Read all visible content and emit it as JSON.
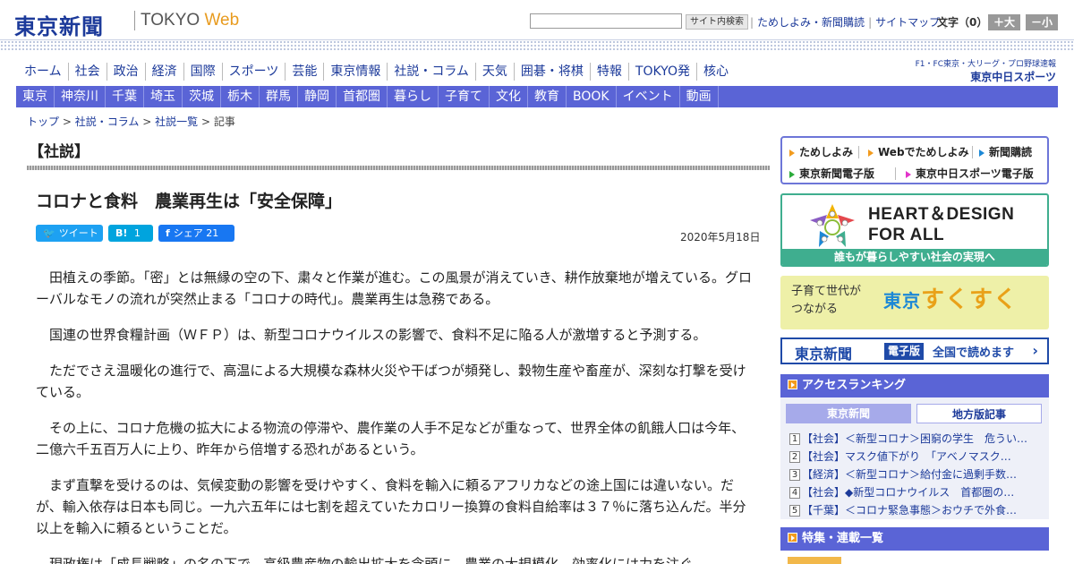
{
  "header": {
    "logo": "東京新聞",
    "brand_tokyo": "TOKYO",
    "brand_web": "Web",
    "search_button": "サイト内検索",
    "links": [
      "ためしよみ・新聞購読",
      "サイトマップ"
    ],
    "font_size_label": "文字（0）",
    "font_big": "＋大",
    "font_small": "－小"
  },
  "nav_primary": [
    "ホーム",
    "社会",
    "政治",
    "経済",
    "国際",
    "スポーツ",
    "芸能",
    "東京情報",
    "社説・コラム",
    "天気",
    "囲碁・将棋",
    "特報",
    "TOKYO発",
    "核心"
  ],
  "sports_logo": {
    "line1": "F1・FC東京・大リーグ・プロ野球速報",
    "line2": "東京中日スポーツ"
  },
  "nav_secondary": [
    "東京",
    "神奈川",
    "千葉",
    "埼玉",
    "茨城",
    "栃木",
    "群馬",
    "静岡",
    "首都圏",
    "暮らし",
    "子育て",
    "文化",
    "教育",
    "BOOK",
    "イベント",
    "動画"
  ],
  "breadcrumb": {
    "items": [
      "トップ",
      "社説・コラム",
      "社説一覧"
    ],
    "current": "記事",
    "sep": ">"
  },
  "article": {
    "section": "【社説】",
    "title": "コロナと食料　農業再生は「安全保障」",
    "share": {
      "tweet": "ツイート",
      "hatena_icon": "B!",
      "hatena_count": "1",
      "facebook_icon": "f",
      "facebook": "シェア 21"
    },
    "date": "2020年5月18日",
    "paragraphs": [
      "田植えの季節。「密」とは無縁の空の下、粛々と作業が進む。この風景が消えていき、耕作放棄地が増えている。グローバルなモノの流れが突然止まる「コロナの時代」。農業再生は急務である。",
      "国連の世界食糧計画（ＷＦＰ）は、新型コロナウイルスの影響で、食料不足に陥る人が激増すると予測する。",
      "ただでさえ温暖化の進行で、高温による大規模な森林火災や干ばつが頻発し、穀物生産や畜産が、深刻な打撃を受けている。",
      "その上に、コロナ危機の拡大による物流の停滞や、農作業の人手不足などが重なって、世界全体の飢餓人口は今年、二億六千五百万人に上り、昨年から倍増する恐れがあるという。",
      "まず直撃を受けるのは、気候変動の影響を受けやすく、食料を輸入に頼るアフリカなどの途上国には違いない。だが、輸入依存は日本も同じ。一九六五年には七割を超えていたカロリー換算の食料自給率は３７％に落ち込んだ。半分以上を輸入に頼るということだ。",
      "現政権は「成長戦略」の名の下で、高級農産物の輸出拡大を念頭に、農業の大規模化、効率化には力を注ぐ"
    ]
  },
  "sidebar": {
    "quick_links": [
      "ためしよみ",
      "Webでためしよみ",
      "新聞購読",
      "東京新聞電子版",
      "東京中日スポーツ電子版"
    ],
    "heart_banner": {
      "title_line1": "HEART＆DESIGN",
      "title_line2": "FOR ALL",
      "footer": "誰もが暮らしやすい社会の実現へ"
    },
    "suku_banner": {
      "sub_line1": "子育て世代が",
      "sub_line2": "つながる",
      "brand_tokyo": "東京",
      "brand_main": "すくすく"
    },
    "denshi_banner": {
      "paper": "東京新聞",
      "badge": "電子版",
      "text": "全国で読めます"
    },
    "ranking": {
      "title": "アクセスランキング",
      "tab_active": "東京新聞",
      "tab_inactive": "地方版記事",
      "items": [
        {
          "num": "1",
          "text": "【社会】＜新型コロナ＞困窮の学生　危うい…"
        },
        {
          "num": "2",
          "text": "【社会】マスク値下がり　「アベノマスク…"
        },
        {
          "num": "3",
          "text": "【経済】＜新型コロナ＞給付金に過剰手数…"
        },
        {
          "num": "4",
          "text": "【社会】◆新型コロナウイルス　首都圏の…"
        },
        {
          "num": "5",
          "text": "【千葉】＜コロナ緊急事態＞おウチで外食…"
        }
      ]
    },
    "features_title": "特集・連載一覧"
  },
  "colors": {
    "brand_blue": "#1c3a9a",
    "nav_purple": "#5a64d6",
    "accent_orange": "#f29b1e",
    "heart_green": "#3fae8f"
  }
}
